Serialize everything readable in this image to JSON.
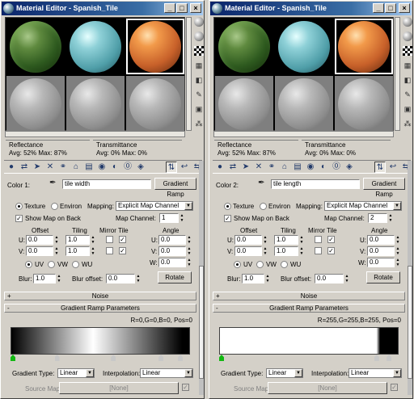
{
  "windows": [
    {
      "title": "Material Editor - Spanish_Tile",
      "color_label": "Color 1:",
      "map_name": "tile width",
      "map_type_button": "Gradient Ramp",
      "coords": {
        "texture": "Texture",
        "environ": "Environ",
        "mapping_label": "Mapping:",
        "mapping_value": "Explicit Map Channel",
        "show_map_on_back": "Show Map on Back",
        "map_channel_label": "Map Channel:",
        "map_channel_value": "1",
        "offset": "Offset",
        "tiling": "Tiling",
        "mirror_tile": "Mirror Tile",
        "angle": "Angle",
        "u": "U:",
        "v": "V:",
        "w": "W:",
        "u_offset": "0.0",
        "v_offset": "0.0",
        "u_tiling": "1.0",
        "v_tiling": "1.0",
        "u_angle": "0.0",
        "v_angle": "0.0",
        "w_angle": "0.0",
        "uv": "UV",
        "vw": "VW",
        "wu": "WU",
        "blur_label": "Blur:",
        "blur_value": "1.0",
        "blur_offset_label": "Blur offset:",
        "blur_offset_value": "0.0",
        "rotate": "Rotate"
      },
      "noise_rollout": "Noise",
      "gradient_rollout": "Gradient Ramp Parameters",
      "rgb_readout": "R=0,G=0,B=0, Pos=0",
      "gradient_type_label": "Gradient Type:",
      "gradient_type_value": "Linear",
      "interpolation_label": "Interpolation:",
      "interpolation_value": "Linear",
      "source_map_label": "Source Map:",
      "source_map_value": "[None]",
      "gradient_css": "linear-gradient(90deg,#000 0%,#ffffff 46%,#000 96%,#000 100%)"
    },
    {
      "title": "Material Editor - Spanish_Tile",
      "color_label": "Color 2:",
      "map_name": "tile length",
      "map_type_button": "Gradient Ramp",
      "coords": {
        "texture": "Texture",
        "environ": "Environ",
        "mapping_label": "Mapping:",
        "mapping_value": "Explicit Map Channel",
        "show_map_on_back": "Show Map on Back",
        "map_channel_label": "Map Channel:",
        "map_channel_value": "2",
        "offset": "Offset",
        "tiling": "Tiling",
        "mirror_tile": "Mirror Tile",
        "angle": "Angle",
        "u": "U:",
        "v": "V:",
        "w": "W:",
        "u_offset": "0.0",
        "v_offset": "0.0",
        "u_tiling": "1.0",
        "v_tiling": "1.0",
        "u_angle": "0.0",
        "v_angle": "0.0",
        "w_angle": "0.0",
        "uv": "UV",
        "vw": "VW",
        "wu": "WU",
        "blur_label": "Blur:",
        "blur_value": "1.0",
        "blur_offset_label": "Blur offset:",
        "blur_offset_value": "0.0",
        "rotate": "Rotate"
      },
      "noise_rollout": "Noise",
      "gradient_rollout": "Gradient Ramp Parameters",
      "rgb_readout": "R=255,G=255,B=255, Pos=0",
      "gradient_type_label": "Gradient Type:",
      "gradient_type_value": "Linear",
      "interpolation_label": "Interpolation:",
      "interpolation_value": "Linear",
      "source_map_label": "Source Map:",
      "source_map_value": "[None]",
      "gradient_css": "linear-gradient(90deg,#fff 0%,#fff 88%,#000 90%,#000 100%)"
    }
  ],
  "common": {
    "reflectance": "Reflectance",
    "transmittance": "Transmittance",
    "refl_avg": "Avg:  52% Max:  87%",
    "trans_avg": "Avg:    0% Max:    0%",
    "plus": "+",
    "minus": "-"
  },
  "icons": [
    "sample-type-icon",
    "backlight-icon",
    "checker-background-icon",
    "sample-uv-tiling-icon",
    "video-check-icon",
    "make-preview-icon",
    "options-icon",
    "select-by-material-icon"
  ]
}
